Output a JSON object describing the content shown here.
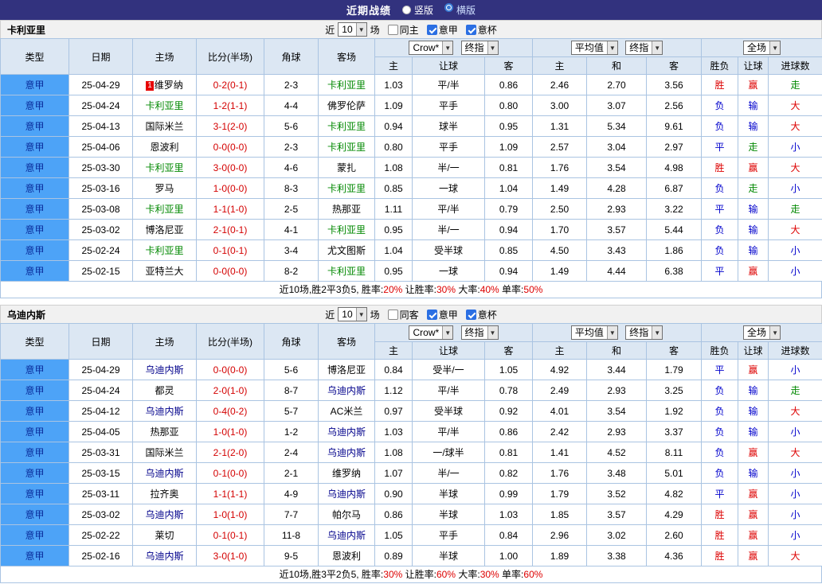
{
  "topbar": {
    "title": "近期战绩",
    "radios": [
      {
        "label": "竖版",
        "selected": false
      },
      {
        "label": "横版",
        "selected": true
      }
    ]
  },
  "labels": {
    "near": "近",
    "matches": "场"
  },
  "table_header": {
    "type": "类型",
    "date": "日期",
    "home": "主场",
    "score": "比分(半场)",
    "corner": "角球",
    "away": "客场",
    "crow_select": "Crow*",
    "final_select": "终指",
    "avg_select": "平均值",
    "final_select2": "终指",
    "scope_select": "全场",
    "odds_home": "主",
    "odds_handicap": "让球",
    "odds_away": "客",
    "avg_home": "主",
    "avg_draw": "和",
    "avg_away": "客",
    "result": "胜负",
    "handicap_result": "让球",
    "goals": "进球数"
  },
  "colors": {
    "red": "#DD0000",
    "blue": "#0000CC",
    "green": "#008800",
    "navy": "#00008B",
    "league_bg": "#4DA3F7",
    "header_bg": "#DCE7F3",
    "topbar_bg": "#32327E"
  },
  "sections": [
    {
      "team": "卡利亚里",
      "count": "10",
      "checkboxes": [
        {
          "label": "同主",
          "checked": false
        },
        {
          "label": "意甲",
          "checked": true
        },
        {
          "label": "意杯",
          "checked": true
        }
      ],
      "rows": [
        {
          "league": "意甲",
          "date": "25-04-29",
          "home": "维罗纳",
          "home_rank": "1",
          "home_color": "black",
          "score": "0-2(0-1)",
          "corner": "2-3",
          "away": "卡利亚里",
          "away_color": "green",
          "o1": "1.03",
          "hcap": "平/半",
          "o2": "0.86",
          "a1": "2.46",
          "a2": "2.70",
          "a3": "3.56",
          "res": "胜",
          "res_c": "red",
          "hres": "赢",
          "hres_c": "red",
          "g": "走",
          "g_c": "green"
        },
        {
          "league": "意甲",
          "date": "25-04-24",
          "home": "卡利亚里",
          "home_color": "green",
          "score": "1-2(1-1)",
          "corner": "4-4",
          "away": "佛罗伦萨",
          "away_color": "black",
          "o1": "1.09",
          "hcap": "平手",
          "o2": "0.80",
          "a1": "3.00",
          "a2": "3.07",
          "a3": "2.56",
          "res": "负",
          "res_c": "blue",
          "hres": "输",
          "hres_c": "blue",
          "g": "大",
          "g_c": "red"
        },
        {
          "league": "意甲",
          "date": "25-04-13",
          "home": "国际米兰",
          "home_color": "black",
          "score": "3-1(2-0)",
          "corner": "5-6",
          "away": "卡利亚里",
          "away_color": "green",
          "o1": "0.94",
          "hcap": "球半",
          "o2": "0.95",
          "a1": "1.31",
          "a2": "5.34",
          "a3": "9.61",
          "res": "负",
          "res_c": "blue",
          "hres": "输",
          "hres_c": "blue",
          "g": "大",
          "g_c": "red"
        },
        {
          "league": "意甲",
          "date": "25-04-06",
          "home": "恩波利",
          "home_color": "black",
          "score": "0-0(0-0)",
          "corner": "2-3",
          "away": "卡利亚里",
          "away_color": "green",
          "o1": "0.80",
          "hcap": "平手",
          "o2": "1.09",
          "a1": "2.57",
          "a2": "3.04",
          "a3": "2.97",
          "res": "平",
          "res_c": "blue",
          "hres": "走",
          "hres_c": "green",
          "g": "小",
          "g_c": "blue"
        },
        {
          "league": "意甲",
          "date": "25-03-30",
          "home": "卡利亚里",
          "home_color": "green",
          "score": "3-0(0-0)",
          "corner": "4-6",
          "away": "蒙扎",
          "away_color": "black",
          "o1": "1.08",
          "hcap": "半/一",
          "o2": "0.81",
          "a1": "1.76",
          "a2": "3.54",
          "a3": "4.98",
          "res": "胜",
          "res_c": "red",
          "hres": "赢",
          "hres_c": "red",
          "g": "大",
          "g_c": "red"
        },
        {
          "league": "意甲",
          "date": "25-03-16",
          "home": "罗马",
          "home_color": "black",
          "score": "1-0(0-0)",
          "corner": "8-3",
          "away": "卡利亚里",
          "away_color": "green",
          "o1": "0.85",
          "hcap": "一球",
          "o2": "1.04",
          "a1": "1.49",
          "a2": "4.28",
          "a3": "6.87",
          "res": "负",
          "res_c": "blue",
          "hres": "走",
          "hres_c": "green",
          "g": "小",
          "g_c": "blue"
        },
        {
          "league": "意甲",
          "date": "25-03-08",
          "home": "卡利亚里",
          "home_color": "green",
          "score": "1-1(1-0)",
          "corner": "2-5",
          "away": "热那亚",
          "away_color": "black",
          "o1": "1.11",
          "hcap": "平/半",
          "o2": "0.79",
          "a1": "2.50",
          "a2": "2.93",
          "a3": "3.22",
          "res": "平",
          "res_c": "blue",
          "hres": "输",
          "hres_c": "blue",
          "g": "走",
          "g_c": "green"
        },
        {
          "league": "意甲",
          "date": "25-03-02",
          "home": "博洛尼亚",
          "home_color": "black",
          "score": "2-1(0-1)",
          "corner": "4-1",
          "away": "卡利亚里",
          "away_color": "green",
          "o1": "0.95",
          "hcap": "半/一",
          "o2": "0.94",
          "a1": "1.70",
          "a2": "3.57",
          "a3": "5.44",
          "res": "负",
          "res_c": "blue",
          "hres": "输",
          "hres_c": "blue",
          "g": "大",
          "g_c": "red"
        },
        {
          "league": "意甲",
          "date": "25-02-24",
          "home": "卡利亚里",
          "home_color": "green",
          "score": "0-1(0-1)",
          "corner": "3-4",
          "away": "尤文图斯",
          "away_color": "black",
          "o1": "1.04",
          "hcap": "受半球",
          "o2": "0.85",
          "a1": "4.50",
          "a2": "3.43",
          "a3": "1.86",
          "res": "负",
          "res_c": "blue",
          "hres": "输",
          "hres_c": "blue",
          "g": "小",
          "g_c": "blue"
        },
        {
          "league": "意甲",
          "date": "25-02-15",
          "home": "亚特兰大",
          "home_color": "black",
          "score": "0-0(0-0)",
          "corner": "8-2",
          "away": "卡利亚里",
          "away_color": "green",
          "o1": "0.95",
          "hcap": "一球",
          "o2": "0.94",
          "a1": "1.49",
          "a2": "4.44",
          "a3": "6.38",
          "res": "平",
          "res_c": "blue",
          "hres": "赢",
          "hres_c": "red",
          "g": "小",
          "g_c": "blue"
        }
      ],
      "summary": [
        {
          "text": "近10场,胜2平3负5, 胜率:",
          "color": "black"
        },
        {
          "text": "20%",
          "color": "red"
        },
        {
          "text": " 让胜率:",
          "color": "black"
        },
        {
          "text": "30%",
          "color": "red"
        },
        {
          "text": " 大率:",
          "color": "black"
        },
        {
          "text": "40%",
          "color": "red"
        },
        {
          "text": " 单率:",
          "color": "black"
        },
        {
          "text": "50%",
          "color": "red"
        }
      ]
    },
    {
      "team": "乌迪内斯",
      "count": "10",
      "checkboxes": [
        {
          "label": "同客",
          "checked": false
        },
        {
          "label": "意甲",
          "checked": true
        },
        {
          "label": "意杯",
          "checked": true
        }
      ],
      "rows": [
        {
          "league": "意甲",
          "date": "25-04-29",
          "home": "乌迪内斯",
          "home_color": "navy",
          "score": "0-0(0-0)",
          "corner": "5-6",
          "away": "博洛尼亚",
          "away_color": "black",
          "o1": "0.84",
          "hcap": "受半/一",
          "o2": "1.05",
          "a1": "4.92",
          "a2": "3.44",
          "a3": "1.79",
          "res": "平",
          "res_c": "blue",
          "hres": "赢",
          "hres_c": "red",
          "g": "小",
          "g_c": "blue"
        },
        {
          "league": "意甲",
          "date": "25-04-24",
          "home": "都灵",
          "home_color": "black",
          "score": "2-0(1-0)",
          "corner": "8-7",
          "away": "乌迪内斯",
          "away_color": "navy",
          "o1": "1.12",
          "hcap": "平/半",
          "o2": "0.78",
          "a1": "2.49",
          "a2": "2.93",
          "a3": "3.25",
          "res": "负",
          "res_c": "blue",
          "hres": "输",
          "hres_c": "blue",
          "g": "走",
          "g_c": "green"
        },
        {
          "league": "意甲",
          "date": "25-04-12",
          "home": "乌迪内斯",
          "home_color": "navy",
          "score": "0-4(0-2)",
          "corner": "5-7",
          "away": "AC米兰",
          "away_color": "black",
          "o1": "0.97",
          "hcap": "受半球",
          "o2": "0.92",
          "a1": "4.01",
          "a2": "3.54",
          "a3": "1.92",
          "res": "负",
          "res_c": "blue",
          "hres": "输",
          "hres_c": "blue",
          "g": "大",
          "g_c": "red"
        },
        {
          "league": "意甲",
          "date": "25-04-05",
          "home": "热那亚",
          "home_color": "black",
          "score": "1-0(1-0)",
          "corner": "1-2",
          "away": "乌迪内斯",
          "away_color": "navy",
          "o1": "1.03",
          "hcap": "平/半",
          "o2": "0.86",
          "a1": "2.42",
          "a2": "2.93",
          "a3": "3.37",
          "res": "负",
          "res_c": "blue",
          "hres": "输",
          "hres_c": "blue",
          "g": "小",
          "g_c": "blue"
        },
        {
          "league": "意甲",
          "date": "25-03-31",
          "home": "国际米兰",
          "home_color": "black",
          "score": "2-1(2-0)",
          "corner": "2-4",
          "away": "乌迪内斯",
          "away_color": "navy",
          "o1": "1.08",
          "hcap": "一/球半",
          "o2": "0.81",
          "a1": "1.41",
          "a2": "4.52",
          "a3": "8.11",
          "res": "负",
          "res_c": "blue",
          "hres": "赢",
          "hres_c": "red",
          "g": "大",
          "g_c": "red"
        },
        {
          "league": "意甲",
          "date": "25-03-15",
          "home": "乌迪内斯",
          "home_color": "navy",
          "score": "0-1(0-0)",
          "corner": "2-1",
          "away": "维罗纳",
          "away_color": "black",
          "o1": "1.07",
          "hcap": "半/一",
          "o2": "0.82",
          "a1": "1.76",
          "a2": "3.48",
          "a3": "5.01",
          "res": "负",
          "res_c": "blue",
          "hres": "输",
          "hres_c": "blue",
          "g": "小",
          "g_c": "blue"
        },
        {
          "league": "意甲",
          "date": "25-03-11",
          "home": "拉齐奥",
          "home_color": "black",
          "score": "1-1(1-1)",
          "corner": "4-9",
          "away": "乌迪内斯",
          "away_color": "navy",
          "o1": "0.90",
          "hcap": "半球",
          "o2": "0.99",
          "a1": "1.79",
          "a2": "3.52",
          "a3": "4.82",
          "res": "平",
          "res_c": "blue",
          "hres": "赢",
          "hres_c": "red",
          "g": "小",
          "g_c": "blue"
        },
        {
          "league": "意甲",
          "date": "25-03-02",
          "home": "乌迪内斯",
          "home_color": "navy",
          "score": "1-0(1-0)",
          "corner": "7-7",
          "away": "帕尔马",
          "away_color": "black",
          "o1": "0.86",
          "hcap": "半球",
          "o2": "1.03",
          "a1": "1.85",
          "a2": "3.57",
          "a3": "4.29",
          "res": "胜",
          "res_c": "red",
          "hres": "赢",
          "hres_c": "red",
          "g": "小",
          "g_c": "blue"
        },
        {
          "league": "意甲",
          "date": "25-02-22",
          "home": "莱切",
          "home_color": "black",
          "score": "0-1(0-1)",
          "corner": "11-8",
          "away": "乌迪内斯",
          "away_color": "navy",
          "o1": "1.05",
          "hcap": "平手",
          "o2": "0.84",
          "a1": "2.96",
          "a2": "3.02",
          "a3": "2.60",
          "res": "胜",
          "res_c": "red",
          "hres": "赢",
          "hres_c": "red",
          "g": "小",
          "g_c": "blue"
        },
        {
          "league": "意甲",
          "date": "25-02-16",
          "home": "乌迪内斯",
          "home_color": "navy",
          "score": "3-0(1-0)",
          "corner": "9-5",
          "away": "恩波利",
          "away_color": "black",
          "o1": "0.89",
          "hcap": "半球",
          "o2": "1.00",
          "a1": "1.89",
          "a2": "3.38",
          "a3": "4.36",
          "res": "胜",
          "res_c": "red",
          "hres": "赢",
          "hres_c": "red",
          "g": "大",
          "g_c": "red"
        }
      ],
      "summary": [
        {
          "text": "近10场,胜3平2负5, 胜率:",
          "color": "black"
        },
        {
          "text": "30%",
          "color": "red"
        },
        {
          "text": " 让胜率:",
          "color": "black"
        },
        {
          "text": "60%",
          "color": "red"
        },
        {
          "text": " 大率:",
          "color": "black"
        },
        {
          "text": "30%",
          "color": "red"
        },
        {
          "text": " 单率:",
          "color": "black"
        },
        {
          "text": "60%",
          "color": "red"
        }
      ]
    }
  ]
}
